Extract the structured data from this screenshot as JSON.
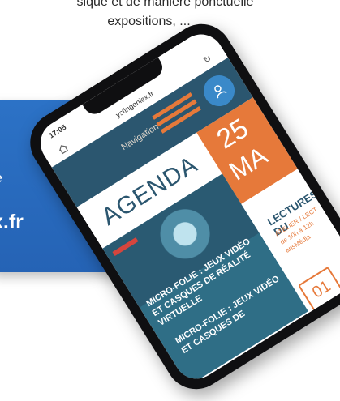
{
  "intro": {
    "line1": "sique et de manière ponctuelle",
    "line2": "expositions, ..."
  },
  "banner": {
    "fragment_text": "lle",
    "fragment_domain": "x.fr",
    "color": "#2c72c6"
  },
  "phone": {
    "status": {
      "time": "17:05"
    },
    "browser": {
      "url": "ystingeniex.fr"
    },
    "header": {
      "nav_label": "Navigation",
      "accent": "#e6793a",
      "bg": "#2b566f"
    },
    "icons": [
      "home-icon",
      "refresh-icon",
      "menu-stripes-icon",
      "user-icon"
    ],
    "agenda_title": "AGENDA",
    "date": {
      "day": "25",
      "month": "MA"
    },
    "event1": {
      "title_a": "MICRO-FOLIE : JEUX VIDÉO ET CASQUES DE RÉALITÉ VIRTUELLE",
      "title_b": "MICRO-FOLIE : JEUX VIDÉO ET CASQUES DE"
    },
    "event2": {
      "title": "LECTURES DU",
      "sub1": "ATELIER / LECT",
      "sub2": "de 10h à 12h",
      "sub3": "ansMédia",
      "day_badge": "01"
    }
  }
}
